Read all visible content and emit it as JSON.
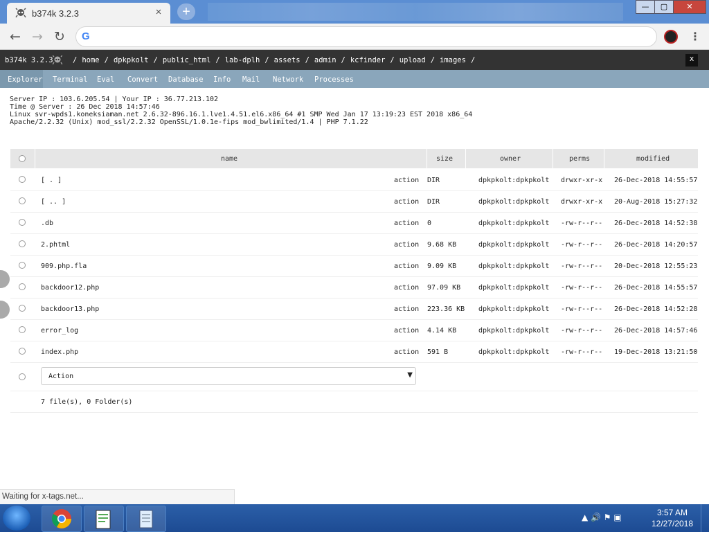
{
  "browser": {
    "tab_title": "b374k 3.2.3",
    "tab_close": "×",
    "new_tab": "+",
    "back": "←",
    "forward": "→",
    "reload": "↻",
    "menu": "⋮",
    "address_value": "",
    "address_placeholder": "",
    "google_glyph": "G",
    "status_text": "Waiting for x-tags.net...",
    "window_controls": {
      "minimize": "—",
      "maximize": "▢",
      "close": "✕"
    }
  },
  "shell": {
    "brand": "b374k 3.2.3",
    "path": [
      {
        "label": "home"
      },
      {
        "label": "dpkpkolt"
      },
      {
        "label": "public_html"
      },
      {
        "label": "lab-dplh"
      },
      {
        "label": "assets"
      },
      {
        "label": "admin"
      },
      {
        "label": "kcfinder"
      },
      {
        "label": "upload"
      },
      {
        "label": "images"
      }
    ],
    "separator": "/",
    "close": "x",
    "menu": [
      "Explorer",
      "Terminal",
      "Eval",
      "Convert",
      "Database",
      "Info",
      "Mail",
      "Network",
      "Processes"
    ],
    "info": [
      "Server IP : 103.6.205.54 | Your IP : 36.77.213.102",
      "Time @ Server : 26 Dec 2018 14:57:46",
      "Linux svr-wpds1.koneksiaman.net 2.6.32-896.16.1.lve1.4.51.el6.x86_64 #1 SMP Wed Jan 17 13:19:23 EST 2018 x86_64",
      "Apache/2.2.32 (Unix) mod_ssl/2.2.32 OpenSSL/1.0.1e-fips mod_bwlimited/1.4 | PHP 7.1.22"
    ]
  },
  "table": {
    "headers": {
      "name": "name",
      "size": "size",
      "owner": "owner",
      "perms": "perms",
      "modified": "modified"
    },
    "rows": [
      {
        "name": "[ . ]",
        "action": "action",
        "size": "DIR",
        "owner": "dpkpkolt:dpkpkolt",
        "perms": "drwxr-xr-x",
        "modified": "26-Dec-2018 14:55:57"
      },
      {
        "name": "[ .. ]",
        "action": "action",
        "size": "DIR",
        "owner": "dpkpkolt:dpkpkolt",
        "perms": "drwxr-xr-x",
        "modified": "20-Aug-2018 15:27:32"
      },
      {
        "name": ".db",
        "action": "action",
        "size": "0",
        "owner": "dpkpkolt:dpkpkolt",
        "perms": "-rw-r--r--",
        "modified": "26-Dec-2018 14:52:38"
      },
      {
        "name": "2.phtml",
        "action": "action",
        "size": "9.68 KB",
        "owner": "dpkpkolt:dpkpkolt",
        "perms": "-rw-r--r--",
        "modified": "26-Dec-2018 14:20:57"
      },
      {
        "name": "909.php.fla",
        "action": "action",
        "size": "9.09 KB",
        "owner": "dpkpkolt:dpkpkolt",
        "perms": "-rw-r--r--",
        "modified": "20-Dec-2018 12:55:23"
      },
      {
        "name": "backdoor12.php",
        "action": "action",
        "size": "97.09 KB",
        "owner": "dpkpkolt:dpkpkolt",
        "perms": "-rw-r--r--",
        "modified": "26-Dec-2018 14:55:57"
      },
      {
        "name": "backdoor13.php",
        "action": "action",
        "size": "223.36 KB",
        "owner": "dpkpkolt:dpkpkolt",
        "perms": "-rw-r--r--",
        "modified": "26-Dec-2018 14:52:28"
      },
      {
        "name": "error_log",
        "action": "action",
        "size": "4.14 KB",
        "owner": "dpkpkolt:dpkpkolt",
        "perms": "-rw-r--r--",
        "modified": "26-Dec-2018 14:57:46"
      },
      {
        "name": "index.php",
        "action": "action",
        "size": "591 B",
        "owner": "dpkpkolt:dpkpkolt",
        "perms": "-rw-r--r--",
        "modified": "19-Dec-2018 13:21:50"
      }
    ],
    "action_select": "Action",
    "select_arrow": "▼",
    "summary": "7 file(s), 0 Folder(s)"
  },
  "taskbar": {
    "time": "3:57 AM",
    "date": "12/27/2018",
    "tray_icons": "▲  🔊  ⚑  ▣"
  },
  "colors": {
    "menubar": "#8aa6bb",
    "header": "#333333",
    "taskbar": "#1d4b93"
  }
}
